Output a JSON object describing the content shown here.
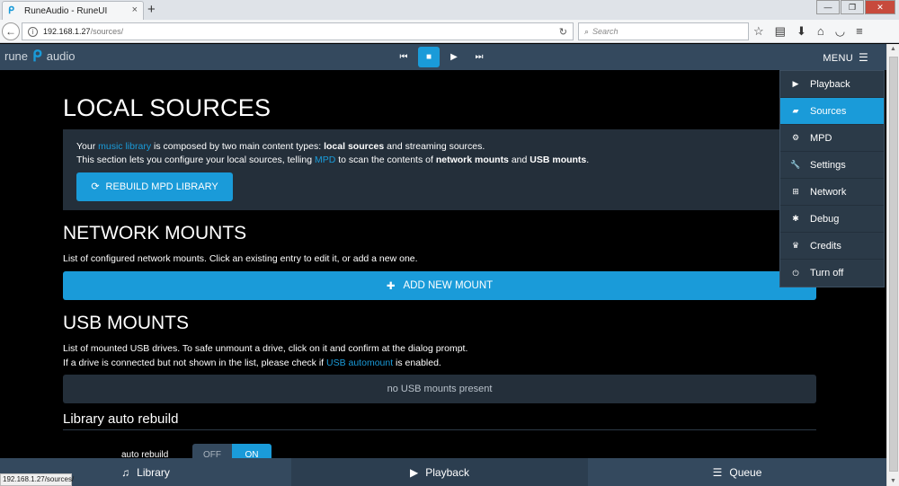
{
  "browser": {
    "tab_title": "RuneAudio - RuneUI",
    "tab_close": "×",
    "new_tab": "+",
    "url_host": "192.168.1.27",
    "url_path": "/sources/",
    "search_placeholder": "Search",
    "status_url": "192.168.1.27/sources/"
  },
  "header": {
    "logo_left": "rune",
    "logo_right": "audio",
    "menu_label": "MENU"
  },
  "page": {
    "title": "LOCAL SOURCES",
    "info": {
      "l1_a": "Your ",
      "l1_link": "music library",
      "l1_b": " is composed by two main content types: ",
      "l1_bold": "local sources",
      "l1_c": " and streaming sources.",
      "l2_a": "This section lets you configure your local sources, telling ",
      "l2_link": "MPD",
      "l2_b": " to scan the contents of ",
      "l2_bold1": "network mounts",
      "l2_c": " and ",
      "l2_bold2": "USB mounts",
      "l2_d": "."
    },
    "rebuild_label": "REBUILD MPD LIBRARY",
    "network_title": "NETWORK MOUNTS",
    "network_desc": "List of configured network mounts. Click an existing entry to edit it, or add a new one.",
    "add_mount_label": "ADD NEW MOUNT",
    "usb_title": "USB MOUNTS",
    "usb_desc1": "List of mounted USB drives. To safe unmount a drive, click on it and confirm at the dialog prompt.",
    "usb_desc2_a": "If a drive is connected but not shown in the list, please check if ",
    "usb_desc2_link": "USB automount",
    "usb_desc2_b": " is enabled.",
    "usb_empty": "no USB mounts present",
    "lib_title": "Library auto rebuild",
    "auto_label": "auto rebuild",
    "toggle_off": "OFF",
    "toggle_on": "ON",
    "toggle_value": "ON"
  },
  "menu": {
    "items": [
      {
        "label": "Playback",
        "icon": "play-icon"
      },
      {
        "label": "Sources",
        "icon": "folder-open-icon",
        "active": true
      },
      {
        "label": "MPD",
        "icon": "cogs-icon"
      },
      {
        "label": "Settings",
        "icon": "wrench-icon"
      },
      {
        "label": "Network",
        "icon": "sitemap-icon"
      },
      {
        "label": "Debug",
        "icon": "bug-icon"
      },
      {
        "label": "Credits",
        "icon": "trophy-icon"
      },
      {
        "label": "Turn off",
        "icon": "power-icon"
      }
    ]
  },
  "bottom": {
    "library": "Library",
    "playback": "Playback",
    "queue": "Queue"
  },
  "colors": {
    "accent": "#1a9bd9",
    "header_bg": "#34495e",
    "panel_bg": "#242f3a"
  }
}
